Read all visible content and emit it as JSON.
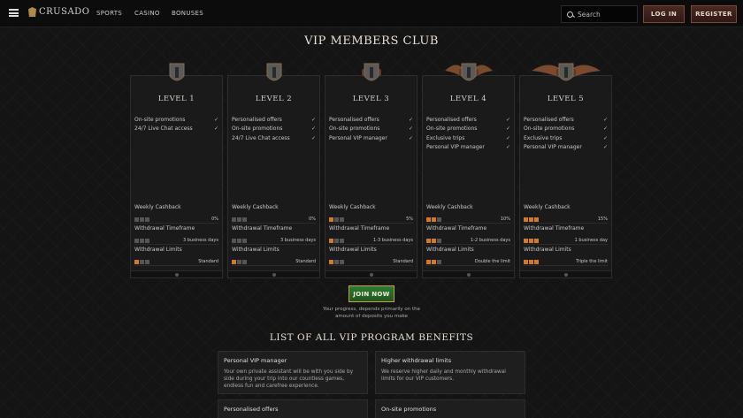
{
  "header": {
    "logo": "CRUSADO",
    "nav": [
      "SPORTS",
      "CASINO",
      "BONUSES"
    ],
    "search_placeholder": "Search",
    "login_label": "LOG IN",
    "register_label": "REGISTER"
  },
  "page_title": "VIP MEMBERS CLUB",
  "section_labels": {
    "cashback": "Weekly Cashback",
    "timeframe": "Withdrawal Timeframe",
    "limits": "Withdrawal Limits"
  },
  "levels": [
    {
      "name": "LEVEL 1",
      "perks": [
        "On-site promotions",
        "24/7 Live Chat access"
      ],
      "cashback": "0%",
      "cashback_level": 0,
      "timeframe": "3 business days",
      "timeframe_level": 0,
      "limits": "Standard",
      "limits_level": 1
    },
    {
      "name": "LEVEL 2",
      "perks": [
        "Personalised offers",
        "On-site promotions",
        "24/7 Live Chat access"
      ],
      "cashback": "0%",
      "cashback_level": 0,
      "timeframe": "3 business days",
      "timeframe_level": 0,
      "limits": "Standard",
      "limits_level": 1
    },
    {
      "name": "LEVEL 3",
      "perks": [
        "Personalised offers",
        "On-site promotions",
        "Personal VIP manager"
      ],
      "cashback": "5%",
      "cashback_level": 1,
      "timeframe": "1-3 business days",
      "timeframe_level": 1,
      "limits": "Standard",
      "limits_level": 1
    },
    {
      "name": "LEVEL 4",
      "perks": [
        "Personalised offers",
        "On-site promotions",
        "Exclusive trips",
        "Personal VIP manager"
      ],
      "cashback": "10%",
      "cashback_level": 2,
      "timeframe": "1-2 business days",
      "timeframe_level": 2,
      "limits": "Double the limit",
      "limits_level": 2
    },
    {
      "name": "LEVEL 5",
      "perks": [
        "Personalised offers",
        "On-site promotions",
        "Exclusive trips",
        "Personal VIP manager"
      ],
      "cashback": "15%",
      "cashback_level": 3,
      "timeframe": "1 business day",
      "timeframe_level": 3,
      "limits": "Triple the limit",
      "limits_level": 3
    }
  ],
  "join_label": "JOIN NOW",
  "join_note": "Your progress, depends primarily on the amount of deposits you make",
  "benefits_title": "LIST OF ALL VIP PROGRAM BENEFITS",
  "benefits": [
    {
      "title": "Personal VIP manager",
      "text": "Your own private assistant will be with you side by side during your trip into our countless games, endless fun and carefree experience."
    },
    {
      "title": "Higher withdrawal limits",
      "text": "We reserve higher daily and monthly withdrawal limits for our VIP customers."
    },
    {
      "title": "Personalised offers",
      "text": ""
    },
    {
      "title": "On-site promotions",
      "text": ""
    }
  ],
  "colors": {
    "accent_orange": "#d07a2a",
    "join_green": "#2f7a32",
    "header_button": "#4a2a24"
  }
}
